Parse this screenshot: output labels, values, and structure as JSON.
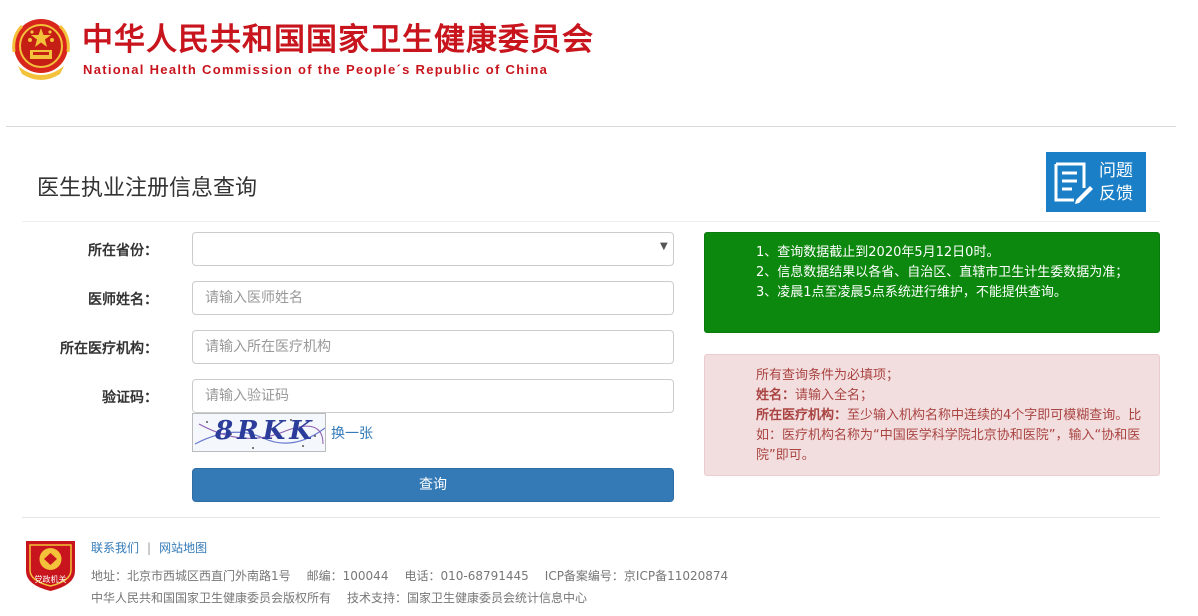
{
  "header": {
    "title_cn": "中华人民共和国国家卫生健康委员会",
    "title_en": "National Health Commission of the People´s Republic of China"
  },
  "page_title": "医生执业注册信息查询",
  "feedback": {
    "line1": "问题",
    "line2": "反馈"
  },
  "form": {
    "province_label": "所在省份：",
    "province_value": "",
    "name_label": "医师姓名：",
    "name_placeholder": "请输入医师姓名",
    "org_label": "所在医疗机构：",
    "org_placeholder": "请输入所在医疗机构",
    "code_label": "验证码：",
    "code_placeholder": "请输入验证码",
    "captcha_text": "8RKK",
    "refresh_label": "换一张",
    "submit_label": "查询"
  },
  "notice_green": [
    "1、查询数据截止到2020年5月12日0时。",
    "2、信息数据结果以各省、自治区、直辖市卫生计生委数据为准；",
    "3、凌晨1点至凌晨5点系统进行维护，不能提供查询。"
  ],
  "notice_red": {
    "line1": "所有查询条件为必填项；",
    "name_key": "姓名：",
    "name_text": "请输入全名；",
    "org_key": "所在医疗机构：",
    "org_text": "至少输入机构名称中连续的4个字即可模糊查询。比如：医疗机构名称为“中国医学科学院北京协和医院”，输入“协和医院”即可。"
  },
  "footer": {
    "link_contact": "联系我们",
    "link_sitemap": "网站地图",
    "badge_text": "党政机关",
    "address": "地址：北京市西城区西直门外南路1号",
    "postcode": "邮编：100044",
    "phone": "电话：010-68791445",
    "icp": "ICP备案编号：京ICP备11020874",
    "copyright": "中华人民共和国国家卫生健康委员会版权所有",
    "support": "技术支持：国家卫生健康委员会统计信息中心"
  },
  "colors": {
    "brand_red": "#c8151d",
    "primary_blue": "#337ab7",
    "notice_green": "#0c880e",
    "notice_red_bg": "#f2dede",
    "feedback_blue": "#1a7fc6"
  }
}
